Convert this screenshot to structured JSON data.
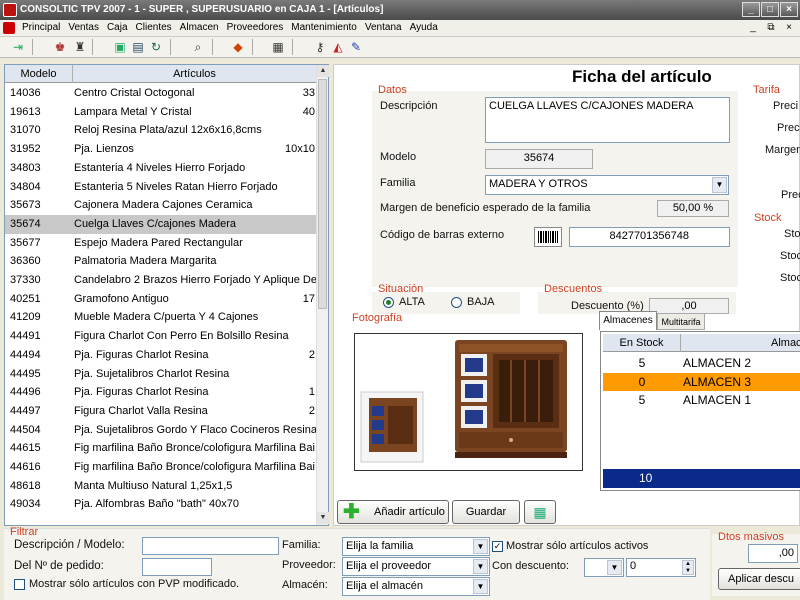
{
  "window": {
    "title": "CONSOLTIC TPV 2007 - 1 - SUPER , SUPERUSUARIO  en CAJA 1 - [Artículos]",
    "controls": [
      "_",
      "□",
      "×"
    ]
  },
  "menu": {
    "items": [
      "Principal",
      "Ventas",
      "Caja",
      "Clientes",
      "Almacen",
      "Proveedores",
      "Mantenimiento",
      "Ventana",
      "Ayuda"
    ],
    "mdi_controls": [
      "_",
      "⧉",
      "×"
    ]
  },
  "toolbar": {
    "icons": [
      "exit-icon",
      "users-icon",
      "shirt-icon",
      "register-icon",
      "cash-icon",
      "refresh-icon",
      "search-icon",
      "chart-icon",
      "building-icon",
      "key-icon",
      "shapes-icon",
      "edit-icon"
    ]
  },
  "list": {
    "headers": [
      "Modelo",
      "Artículos"
    ],
    "rows": [
      {
        "modelo": "14036",
        "articulo": "Centro Cristal Octogonal",
        "extra": "33"
      },
      {
        "modelo": "19613",
        "articulo": "Lampara Metal Y Cristal",
        "extra": "40"
      },
      {
        "modelo": "31070",
        "articulo": "Reloj Resina Plata/azul 12x6x16,8cms",
        "extra": ""
      },
      {
        "modelo": "31952",
        "articulo": "Pja. Lienzos",
        "extra": "10x10"
      },
      {
        "modelo": "34803",
        "articulo": "Estanteria 4 Niveles Hierro Forjado",
        "extra": ""
      },
      {
        "modelo": "34804",
        "articulo": "Estanteria 5 Niveles Ratan Hierro Forjado",
        "extra": ""
      },
      {
        "modelo": "35673",
        "articulo": "Cajonera Madera Cajones Ceramica",
        "extra": ""
      },
      {
        "modelo": "35674",
        "articulo": "Cuelga Llaves C/cajones Madera",
        "extra": ""
      },
      {
        "modelo": "35677",
        "articulo": "Espejo Madera Pared Rectangular",
        "extra": ""
      },
      {
        "modelo": "36360",
        "articulo": "Palmatoria Madera Margarita",
        "extra": ""
      },
      {
        "modelo": "37330",
        "articulo": "Candelabro 2 Brazos Hierro Forjado Y Aplique De",
        "extra": ""
      },
      {
        "modelo": "40251",
        "articulo": "Gramofono Antiguo",
        "extra": "17"
      },
      {
        "modelo": "41209",
        "articulo": "Mueble Madera C/puerta Y 4 Cajones",
        "extra": ""
      },
      {
        "modelo": "44491",
        "articulo": "Figura Charlot Con Perro En Bolsillo Resina",
        "extra": ""
      },
      {
        "modelo": "44494",
        "articulo": "Pja. Figuras Charlot Resina",
        "extra": "2"
      },
      {
        "modelo": "44495",
        "articulo": "Pja. Sujetalibros Charlot Resina",
        "extra": ""
      },
      {
        "modelo": "44496",
        "articulo": "Pja. Figuras Charlot Resina",
        "extra": "1"
      },
      {
        "modelo": "44497",
        "articulo": "Figura Charlot Valla Resina",
        "extra": "2"
      },
      {
        "modelo": "44504",
        "articulo": "Pja. Sujetalibros Gordo Y Flaco Cocineros Resina",
        "extra": ""
      },
      {
        "modelo": "44615",
        "articulo": "Fig marfilina Baño Bronce/colofigura Marfilina Bai",
        "extra": ""
      },
      {
        "modelo": "44616",
        "articulo": "Fig marfilina Baño Bronce/colofigura Marfilina Bai",
        "extra": ""
      },
      {
        "modelo": "48618",
        "articulo": "Manta Multiuso Natural 1,25x1,5",
        "extra": ""
      },
      {
        "modelo": "49034",
        "articulo": "Pja. Alfombras Baño \"bath\" 40x70",
        "extra": ""
      }
    ],
    "selected_index": 7
  },
  "ficha": {
    "title": "Ficha del artículo",
    "datos": {
      "section": "Datos",
      "descripcion_label": "Descripción",
      "descripcion_value": "CUELGA LLAVES C/CAJONES MADERA",
      "modelo_label": "Modelo",
      "modelo_value": "35674",
      "familia_label": "Familia",
      "familia_value": "MADERA Y OTROS",
      "margen_label": "Margen de beneficio esperado de la familia",
      "margen_value": "50,00 %",
      "barcode_label": "Código de barras externo",
      "barcode_value": "8427701356748"
    },
    "tarifa": {
      "section": "Tarifa",
      "labels": [
        "Preci",
        "Prec",
        "Margen",
        "Prec"
      ]
    },
    "stock": {
      "section": "Stock",
      "labels": [
        "Stoc",
        "Stoc",
        "Stoc"
      ]
    },
    "situacion": {
      "section": "Situación",
      "options": [
        "ALTA",
        "BAJA"
      ],
      "selected": "ALTA"
    },
    "descuentos": {
      "section": "Descuentos",
      "label": "Descuento (%)",
      "value": ",00"
    },
    "fotografia": {
      "section": "Fotografía"
    },
    "tabs": [
      "Almacenes",
      "Multitarifa"
    ],
    "almacenes": {
      "headers": [
        "En Stock",
        "Almac"
      ],
      "rows": [
        {
          "stock": "5",
          "almacen": "ALMACEN 2"
        },
        {
          "stock": "0",
          "almacen": "ALMACEN 3"
        },
        {
          "stock": "5",
          "almacen": "ALMACEN 1"
        }
      ],
      "highlight_index": 1,
      "total": "10"
    },
    "buttons": {
      "anadir": "Añadir artículo",
      "guardar": "Guardar"
    }
  },
  "filtrar": {
    "section": "Filtrar",
    "desc_label": "Descripción / Modelo:",
    "pedido_label": "Del Nº de pedido:",
    "pvp_check_label": "Mostrar sólo artículos con PVP modificado.",
    "familia_label": "Familia:",
    "familia_value": "Elija la familia",
    "proveedor_label": "Proveedor:",
    "proveedor_value": "Elija el proveedor",
    "almacen_label": "Almacén:",
    "almacen_value": "Elija el almacén",
    "activos_label": "Mostrar sólo artículos activos",
    "activos_checked": true,
    "condescuento_label": "Con descuento:",
    "condescuento_value": "0"
  },
  "dtos_masivos": {
    "section": "Dtos masivos",
    "value": ",00",
    "button": "Aplicar descu"
  },
  "colors": {
    "section_title": "#d04020",
    "selected_row": "#c8c8c8",
    "highlight_row": "#ff9a00",
    "total_bar": "#0a2a8a"
  }
}
